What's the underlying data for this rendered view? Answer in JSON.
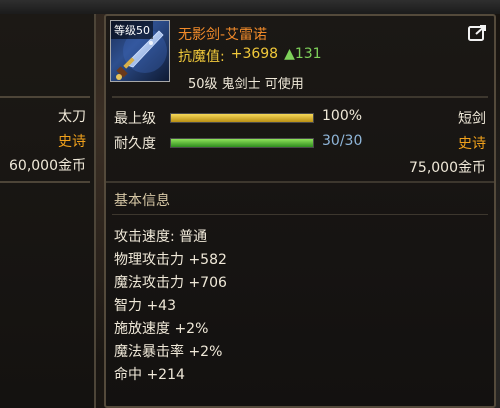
{
  "left_panel": {
    "type": "太刀",
    "rarity": "史诗",
    "price": "60,000金币"
  },
  "item": {
    "level_badge": "等级50",
    "name": "无影剑-艾雷诺",
    "resist_label": "抗魔值:",
    "resist_value": "+3698",
    "resist_bonus": "▲131",
    "requirement": "50级 鬼剑士 可使用",
    "icon": "sword-icon"
  },
  "stats": {
    "upgrade_label": "最上级",
    "upgrade_value": "100%",
    "upgrade_fill": 1.0,
    "durability_label": "耐久度",
    "durability_value": "30/30",
    "durability_fill": 1.0
  },
  "right": {
    "type": "短剑",
    "rarity": "史诗",
    "price": "75,000金币"
  },
  "basic_info": {
    "title": "基本信息",
    "attributes": [
      "攻击速度: 普通",
      "物理攻击力 +582",
      "魔法攻击力 +706",
      "智力 +43",
      "施放速度 +2%",
      "魔法暴击率 +2%",
      "命中 +214"
    ]
  },
  "colors": {
    "name": "#f08a2a",
    "rarity": "#f0a11c",
    "resist": "#f0c83a",
    "bonus": "#7ed15a"
  }
}
